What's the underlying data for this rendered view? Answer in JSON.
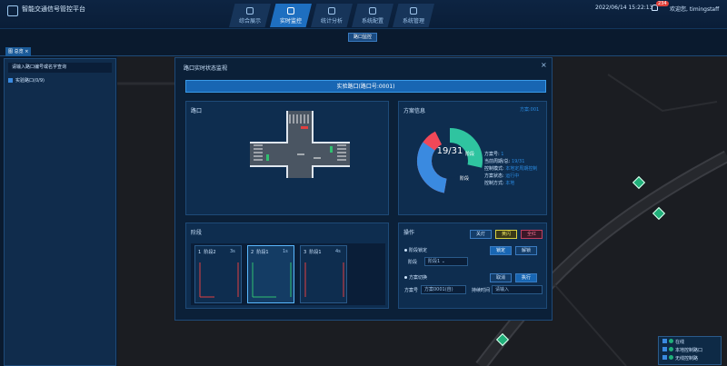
{
  "header": {
    "app_title": "智能交通信号管控平台",
    "datetime": "2022/06/14 15:22:13",
    "notification_count": "234",
    "username": "欢迎您, timingstaff",
    "nav": [
      {
        "label": "综合展示",
        "active": false
      },
      {
        "label": "实时监控",
        "active": true
      },
      {
        "label": "统计分析",
        "active": false
      },
      {
        "label": "系统配置",
        "active": false
      },
      {
        "label": "系统管理",
        "active": false
      }
    ]
  },
  "subtoggle": "路口监控",
  "tab": {
    "label": "图 总览",
    "close": "×"
  },
  "sidebar": {
    "search_placeholder": "请输入路口编号或名字查询",
    "items": [
      {
        "label": "实验路口(0/9)"
      }
    ]
  },
  "legend": {
    "title": "在线",
    "items": [
      {
        "label": "本地控制路口"
      },
      {
        "label": "无线控制路"
      }
    ]
  },
  "modal": {
    "title": "路口实时状态监视",
    "close": "×",
    "banner": "实验路口(路口号:0001)",
    "crossing_title": "路口",
    "plan_title": "方案信息",
    "plan_count": "方案:001",
    "donut_label": "19/31",
    "segment_labels": [
      "阶段",
      "阶段"
    ],
    "stats": [
      {
        "key": "方案号:",
        "value": "1"
      },
      {
        "key": "当前周期/总:",
        "value": "19/31"
      },
      {
        "key": "控制模式:",
        "value": "本地定周期控制"
      },
      {
        "key": "方案状态:",
        "value": "运行中"
      },
      {
        "key": "控制方式:",
        "value": "本地"
      }
    ],
    "phase_title": "阶段",
    "phases": [
      {
        "no": "1",
        "name": "阶段2",
        "time": "3s"
      },
      {
        "no": "2",
        "name": "阶段1",
        "time": "1s"
      },
      {
        "no": "3",
        "name": "阶段1",
        "time": "4s"
      }
    ],
    "ops": {
      "title": "操作",
      "btn_all_red": "关灯",
      "btn_yellow": "黄闪",
      "btn_red": "全红",
      "phase_lock_label": "阶段锁定",
      "btn_lock": "锁定",
      "btn_unlock": "解锁",
      "phase_field_label": "阶段",
      "phase_field_value": "阶段1",
      "plan_switch_label": "方案切换",
      "btn_cancel": "取消",
      "btn_execute": "执行",
      "plan_no_label": "方案号",
      "plan_no_value": "方案0001(自)",
      "duration_label": "持续时间",
      "duration_placeholder": "请输入"
    }
  },
  "colors": {
    "accent": "#1e6fc0",
    "donut_green": "#2fc4a0",
    "donut_blue": "#3a8ae0",
    "donut_red": "#f04858",
    "marker": "#20b07a"
  }
}
